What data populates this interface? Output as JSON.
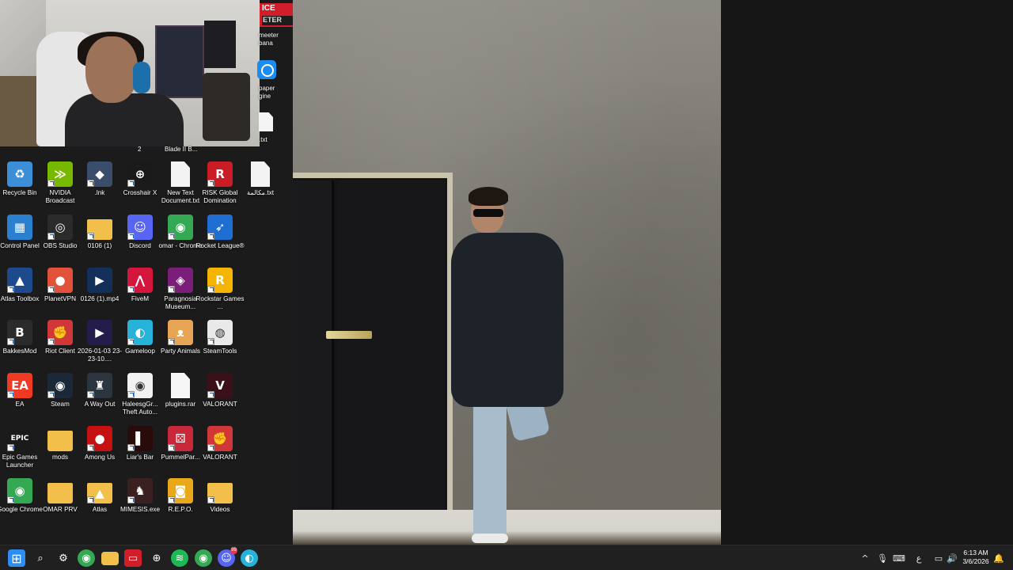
{
  "webcam": {
    "under_labels": [
      "2",
      "Blade II B..."
    ]
  },
  "partial_icons": [
    {
      "name": "voicemeeter-icon",
      "icon_text_top": "ICE",
      "icon_text_bottom": "ETER",
      "label": "meeter\nbana"
    },
    {
      "name": "wallpaper-engine-icon",
      "label": "paper\ngine"
    },
    {
      "name": "text-file-icon",
      "label": ".txt"
    }
  ],
  "desktop_icons": [
    {
      "name": "recycle-bin",
      "label": "Recycle Bin",
      "icon": "recycle-bin-icon",
      "color": "#3c8fd6",
      "glyph": "♻",
      "shortcut": false
    },
    {
      "name": "nvidia-broadcast",
      "label": "NVIDIA Broadcast",
      "icon": "nvidia-icon",
      "color": "#76b900",
      "glyph": "≫",
      "shortcut": true
    },
    {
      "name": "lnk-file",
      "label": ".lnk",
      "icon": "pubg-icon",
      "color": "#3a4d6a",
      "glyph": "◆",
      "shortcut": true
    },
    {
      "name": "crosshair-x",
      "label": "Crosshair X",
      "icon": "crosshair-icon",
      "color": "#1a1a1a",
      "glyph": "⊕",
      "shortcut": true
    },
    {
      "name": "new-text-document",
      "label": "New Text Document.txt",
      "icon": "text-document-icon",
      "color": "#f3f3f3",
      "glyph": "",
      "shortcut": false
    },
    {
      "name": "risk-global-domination",
      "label": "RISK Global Domination",
      "icon": "risk-icon",
      "color": "#c81d25",
      "glyph": "R",
      "shortcut": true
    },
    {
      "name": "arabic-text-file",
      "label": "مكالمة.txt",
      "icon": "text-document-icon",
      "color": "#f3f3f3",
      "glyph": "",
      "shortcut": false
    },
    {
      "name": "control-panel",
      "label": "Control Panel",
      "icon": "control-panel-icon",
      "color": "#2a7fcf",
      "glyph": "▦",
      "shortcut": false
    },
    {
      "name": "obs-studio",
      "label": "OBS Studio",
      "icon": "obs-icon",
      "color": "#2b2b2b",
      "glyph": "◎",
      "shortcut": true
    },
    {
      "name": "folder-0106",
      "label": "0106 (1)",
      "icon": "folder-icon",
      "color": "#f2c04a",
      "glyph": "",
      "shortcut": true
    },
    {
      "name": "discord",
      "label": "Discord",
      "icon": "discord-icon",
      "color": "#5865f2",
      "glyph": "☺",
      "shortcut": true
    },
    {
      "name": "omar-chrome",
      "label": "omar - Chrome",
      "icon": "chrome-icon",
      "color": "#34a853",
      "glyph": "◉",
      "shortcut": true
    },
    {
      "name": "rocket-league",
      "label": "Rocket League®",
      "icon": "rocket-league-icon",
      "color": "#1f6ed1",
      "glyph": "➶",
      "shortcut": true
    },
    {
      "name": "atlas-toolbox",
      "label": "Atlas Toolbox",
      "icon": "atlas-toolbox-icon",
      "color": "#1c4a8c",
      "glyph": "▲",
      "shortcut": true
    },
    {
      "name": "planetvpn",
      "label": "PlanetVPN",
      "icon": "planetvpn-icon",
      "color": "#e2513a",
      "glyph": "●",
      "shortcut": true
    },
    {
      "name": "video-0126",
      "label": "0126 (1).mp4",
      "icon": "video-file-icon",
      "color": "#13305a",
      "glyph": "▶",
      "shortcut": false
    },
    {
      "name": "fivem",
      "label": "FiveM",
      "icon": "fivem-icon",
      "color": "#d4163d",
      "glyph": "⋀",
      "shortcut": true
    },
    {
      "name": "paragnosia-museum",
      "label": "Paragnosia Museum...",
      "icon": "paragnosia-icon",
      "color": "#7a1e7a",
      "glyph": "◈",
      "shortcut": true
    },
    {
      "name": "rockstar-games",
      "label": "Rockstar Games ...",
      "icon": "rockstar-icon",
      "color": "#f5b400",
      "glyph": "R",
      "shortcut": true
    },
    {
      "name": "bakkesmod",
      "label": "BakkesMod",
      "icon": "bakkesmod-icon",
      "color": "#2b2b2b",
      "glyph": "B",
      "shortcut": true
    },
    {
      "name": "riot-client",
      "label": "Riot Client",
      "icon": "riot-icon",
      "color": "#d13639",
      "glyph": "✊",
      "shortcut": true
    },
    {
      "name": "recording-2026-01-03",
      "label": "2026-01-03 23-23-10....",
      "icon": "video-file-icon",
      "color": "#241c4a",
      "glyph": "▶",
      "shortcut": false
    },
    {
      "name": "gameloop",
      "label": "Gameloop",
      "icon": "gameloop-icon",
      "color": "#27b3d9",
      "glyph": "◐",
      "shortcut": true
    },
    {
      "name": "party-animals",
      "label": "Party Animals",
      "icon": "party-animals-icon",
      "color": "#e8a655",
      "glyph": "ᴥ",
      "shortcut": true
    },
    {
      "name": "steamtools",
      "label": "SteamTools",
      "icon": "steamtools-icon",
      "color": "#e9e9e9",
      "glyph": "◍",
      "shortcut": true
    },
    {
      "name": "ea",
      "label": "EA",
      "icon": "ea-icon",
      "color": "#ef3b24",
      "glyph": "EA",
      "shortcut": true
    },
    {
      "name": "steam",
      "label": "Steam",
      "icon": "steam-icon",
      "color": "#1b2838",
      "glyph": "◉",
      "shortcut": true
    },
    {
      "name": "a-way-out",
      "label": "A Way Out",
      "icon": "a-way-out-icon",
      "color": "#2b3540",
      "glyph": "♜",
      "shortcut": true
    },
    {
      "name": "haleesgr-theft-auto",
      "label": "HaleesgGr... Theft Auto...",
      "icon": "chrome-icon",
      "color": "#f1f1f1",
      "glyph": "◉",
      "shortcut": true
    },
    {
      "name": "plugins-rar",
      "label": "plugins.rar",
      "icon": "archive-file-icon",
      "color": "#f6f6f6",
      "glyph": "",
      "shortcut": false
    },
    {
      "name": "valorant",
      "label": "VALORANT",
      "icon": "valorant-icon",
      "color": "#3a1119",
      "glyph": "V",
      "shortcut": true
    },
    {
      "name": "epic-games-launcher",
      "label": "Epic Games Launcher",
      "icon": "epic-games-icon",
      "color": "#1a1a1a",
      "glyph": "EPIC",
      "shortcut": true
    },
    {
      "name": "mods-folder",
      "label": "mods",
      "icon": "folder-icon",
      "color": "#f2c04a",
      "glyph": "",
      "shortcut": false
    },
    {
      "name": "among-us",
      "label": "Among Us",
      "icon": "among-us-icon",
      "color": "#c51111",
      "glyph": "●",
      "shortcut": true
    },
    {
      "name": "liars-bar",
      "label": "Liar's Bar",
      "icon": "liars-bar-icon",
      "color": "#2a0b0b",
      "glyph": "▌",
      "shortcut": true
    },
    {
      "name": "pummelparty",
      "label": "PummelPar...",
      "icon": "pummel-party-icon",
      "color": "#c8283a",
      "glyph": "⚄",
      "shortcut": true
    },
    {
      "name": "valorant-2",
      "label": "VALORANT",
      "icon": "riot-icon",
      "color": "#d13639",
      "glyph": "✊",
      "shortcut": true
    },
    {
      "name": "google-chrome",
      "label": "Google Chrome",
      "icon": "chrome-icon",
      "color": "#34a853",
      "glyph": "◉",
      "shortcut": true
    },
    {
      "name": "omar-prv",
      "label": "OMAR PRV",
      "icon": "folder-icon",
      "color": "#f2c04a",
      "glyph": "",
      "shortcut": false
    },
    {
      "name": "atlas",
      "label": "Atlas",
      "icon": "folder-icon",
      "color": "#f2c04a",
      "glyph": "▲",
      "shortcut": true
    },
    {
      "name": "mimesis",
      "label": "MIMESIS.exe",
      "icon": "mimesis-icon",
      "color": "#3a2020",
      "glyph": "♞",
      "shortcut": true
    },
    {
      "name": "repo",
      "label": "R.E.P.O.",
      "icon": "repo-icon",
      "color": "#e9a81a",
      "glyph": "◙",
      "shortcut": true
    },
    {
      "name": "videos",
      "label": "Videos",
      "icon": "folder-icon",
      "color": "#f2c04a",
      "glyph": "",
      "shortcut": true
    }
  ],
  "taskbar": {
    "apps": [
      {
        "name": "start-button",
        "icon": "windows-icon",
        "color": "#2d8df0",
        "glyph": "⊞"
      },
      {
        "name": "taskbar-search",
        "icon": "search-icon",
        "color": "transparent",
        "glyph": "⌕"
      },
      {
        "name": "taskbar-settings",
        "icon": "gear-icon",
        "color": "transparent",
        "glyph": "⚙"
      },
      {
        "name": "taskbar-chrome",
        "icon": "chrome-icon",
        "color": "#34a853",
        "glyph": "◉"
      },
      {
        "name": "taskbar-file-explorer",
        "icon": "folder-icon",
        "color": "#f2c04a",
        "glyph": ""
      },
      {
        "name": "taskbar-voicemeeter",
        "icon": "voicemeeter-icon",
        "color": "#d01f2a",
        "glyph": "▭"
      },
      {
        "name": "taskbar-crosshair",
        "icon": "crosshair-icon",
        "color": "transparent",
        "glyph": "⊕"
      },
      {
        "name": "taskbar-spotify",
        "icon": "spotify-icon",
        "color": "#1db954",
        "glyph": "≋"
      },
      {
        "name": "taskbar-chrome-profile",
        "icon": "chrome-icon",
        "color": "#34a853",
        "glyph": "◉"
      },
      {
        "name": "taskbar-discord",
        "icon": "discord-icon",
        "color": "#5865f2",
        "glyph": "☺",
        "badge": "99"
      },
      {
        "name": "taskbar-app",
        "icon": "app-icon",
        "color": "#27b3d9",
        "glyph": "◐"
      }
    ],
    "tray": {
      "chevron": "^",
      "mic": "🎙",
      "keyboard": "⌨",
      "lang": "ع",
      "display": "▭",
      "volume": "🔊",
      "notification": "🔔"
    },
    "time": "6:13 AM",
    "date": "3/6/2026"
  }
}
